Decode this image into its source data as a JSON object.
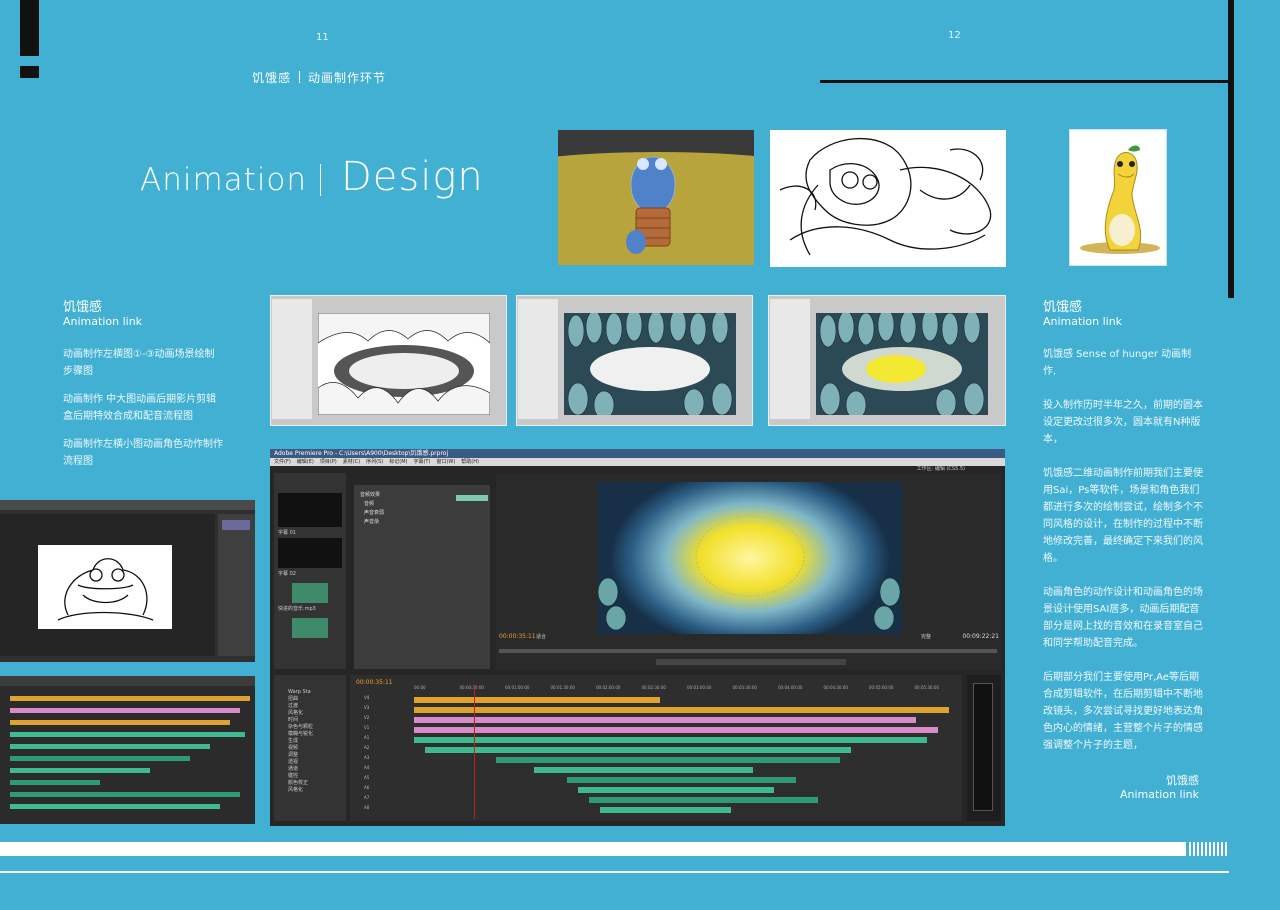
{
  "page": {
    "left_number": "11",
    "right_number": "12",
    "section_title_cn": "饥饿感",
    "section_title_sub": "动画制作环节"
  },
  "hero": {
    "word1": "Animation",
    "word2": "Design"
  },
  "left_panel": {
    "title": "饥饿感",
    "subtitle": "Animation link",
    "paragraphs": [
      "动画制作左横图①-③动画场景绘制步骤图",
      "动画制作 中大图动画后期影片剪辑盒后期特效合成和配音流程图",
      "动画制作左横小图动画角色动作制作流程图"
    ]
  },
  "right_panel": {
    "title": "饥饿感",
    "subtitle": "Animation link",
    "paragraphs": [
      "饥饿感 Sense of hunger 动画制作,",
      "投入制作历时半年之久，前期的圆本设定更改过很多次，圆本就有N种版本，",
      "饥饿感二维动画制作前期我们主要使用Sai，Ps等软件，场景和角色我们都进行多次的绘制尝试，绘制多个不同风格的设计，在制作的过程中不断地修改完善，最终确定下来我们的风格。",
      "动画角色的动作设计和动画角色的场景设计使用SAI居多，动画后期配音部分是网上找的音效和在录音室自己和同学帮助配音完成。",
      "后期部分我们主要使用Pr,Ae等后期合成剪辑软件，在后期剪辑中不断地改镜头，多次尝试寻找更好地表达角色内心的情绪，主营整个片子的情感强调整个片子的主题，"
    ],
    "footer_title": "饥饿感",
    "footer_sub": "Animation link"
  },
  "premiere": {
    "title_bar": "Adobe Premiere Pro - C:\\Users\\A900\\Desktop\\饥饿感.prproj",
    "menu": [
      "文件(F)",
      "编辑(E)",
      "项目(P)",
      "素材(C)",
      "序列(S)",
      "标记(M)",
      "字幕(T)",
      "窗口(W)",
      "帮助(H)"
    ],
    "timecode_left": "00:00:35:11",
    "timecode_right": "00:09:22:21",
    "fit_label": "适合",
    "full_label": "完整",
    "timeline_timecode": "00:00:35:11",
    "workspace_label": "工作区:",
    "workspace_value": "编辑 (CS5.5)",
    "project_items": [
      "字幕 01",
      "字幕 02",
      "快进的音乐.mp3"
    ],
    "effects": [
      "音频效果",
      "音频",
      "声音衰弱",
      "声音渐"
    ],
    "ruler": [
      "00:00",
      "00:00:30:00",
      "00:01:00:00",
      "00:01:30:00",
      "00:02:00:00",
      "00:02:30:00",
      "00:03:00:00",
      "00:03:30:00",
      "00:04:00:00",
      "00:04:30:00",
      "00:05:00:00",
      "00:05:30:00"
    ],
    "tracks": [
      "V4",
      "V3",
      "V2",
      "V1",
      "A1",
      "A2",
      "A3",
      "A4",
      "A5",
      "A6",
      "A7",
      "A8"
    ],
    "effects_tree": [
      "Warp Sta",
      "扭曲",
      "过渡",
      "风格化",
      "时间",
      "杂色与颗粒",
      "模糊与锐化",
      "生成",
      "视频",
      "调整",
      "透视",
      "通道",
      "键控",
      "颜色校正",
      "风格化"
    ],
    "colors": {
      "clip_orange": "#e0a22e",
      "clip_pink": "#d98ac8",
      "clip_green": "#3fba8e",
      "clip_teal": "#2d9b78"
    }
  },
  "colors": {
    "background": "#41b0d3",
    "accent_dark": "#111111"
  }
}
